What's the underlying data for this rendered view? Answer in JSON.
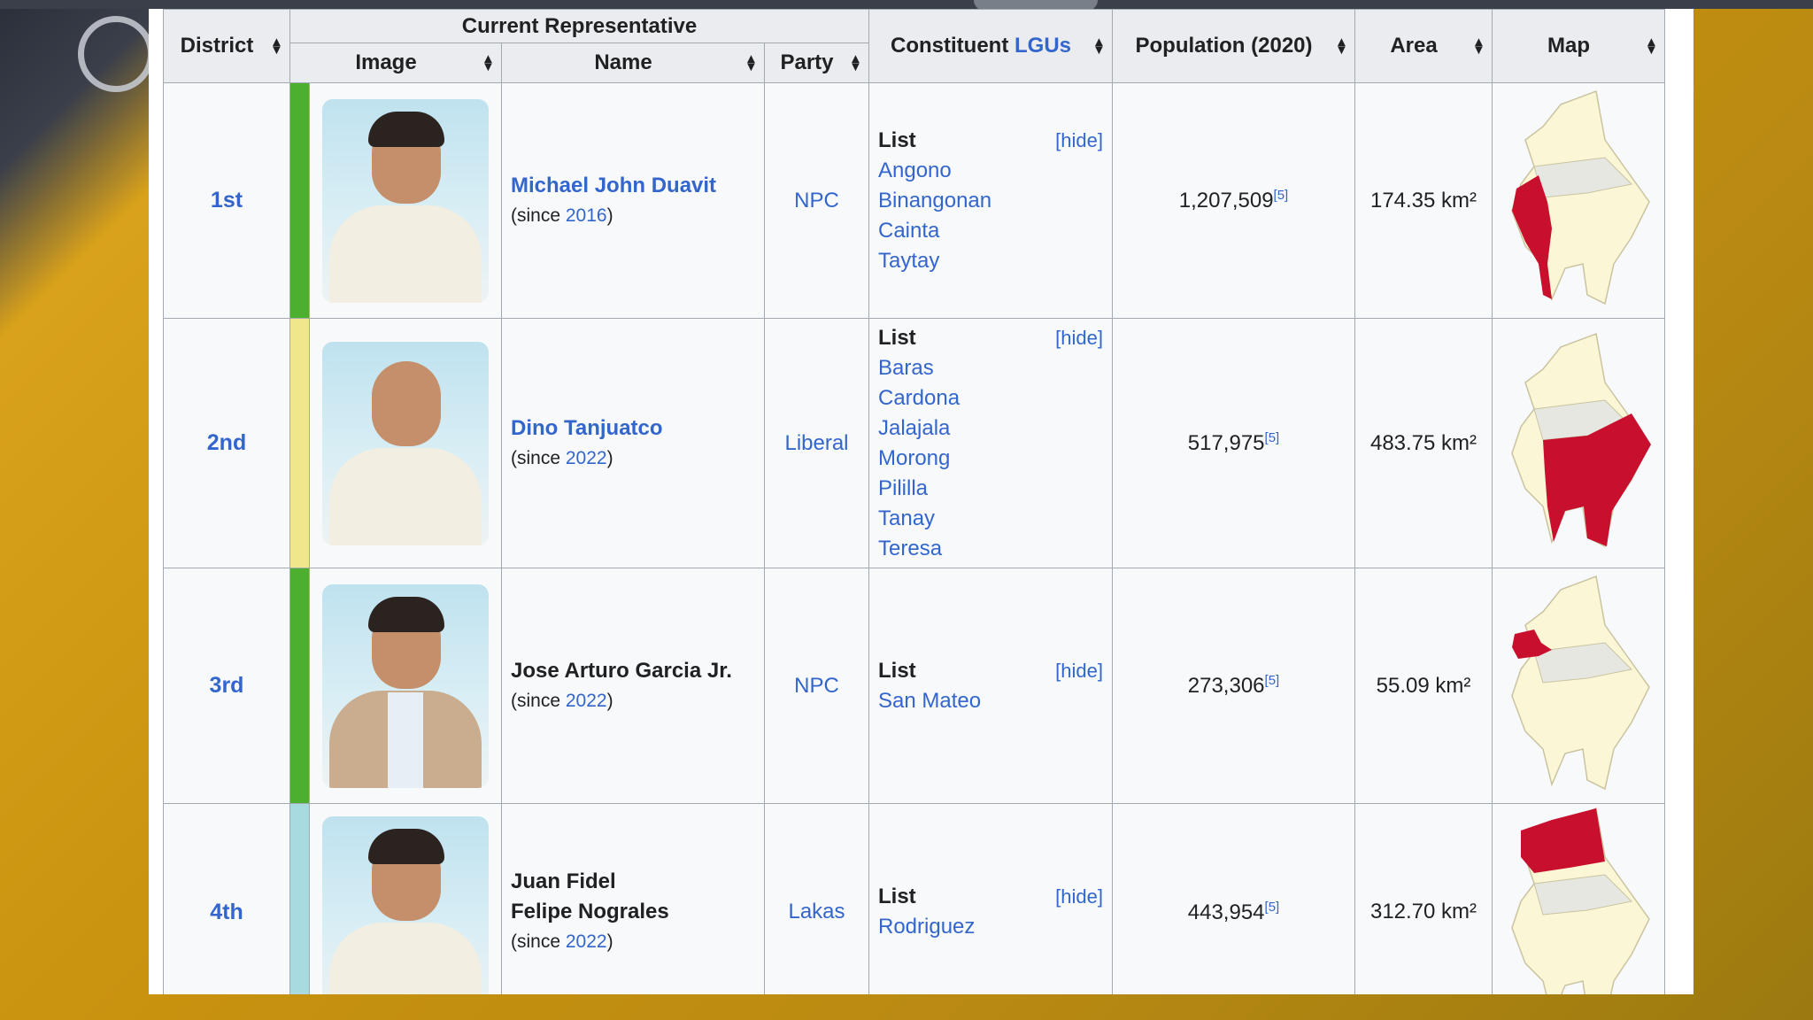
{
  "headers": {
    "district": "District",
    "current_rep": "Current Representative",
    "image": "Image",
    "name": "Name",
    "party": "Party",
    "lgus_prefix": "Constituent ",
    "lgus_link": "LGUs",
    "population": "Population (2020)",
    "area": "Area",
    "map": "Map"
  },
  "list_label": "List",
  "hide_label": "[hide]",
  "rows": [
    {
      "district": "1st",
      "bar_color": "#4caf2f",
      "name": "Michael John Duavit",
      "name_is_link": true,
      "since_prefix": "(since ",
      "since_year": "2016",
      "since_suffix": ")",
      "party": "NPC",
      "lgus": [
        "Angono",
        "Binangonan",
        "Cainta",
        "Taytay"
      ],
      "population": "1,207,509",
      "ref": "[5]",
      "area": "174.35 km²"
    },
    {
      "district": "2nd",
      "bar_color": "#f0e68c",
      "name": "Dino Tanjuatco",
      "name_is_link": true,
      "since_prefix": "(since ",
      "since_year": "2022",
      "since_suffix": ")",
      "party": "Liberal",
      "lgus": [
        "Baras",
        "Cardona",
        "Jalajala",
        "Morong",
        "Pililla",
        "Tanay",
        "Teresa"
      ],
      "population": "517,975",
      "ref": "[5]",
      "area": "483.75 km²"
    },
    {
      "district": "3rd",
      "bar_color": "#4caf2f",
      "name": "Jose Arturo Garcia Jr.",
      "name_is_link": false,
      "since_prefix": "(since ",
      "since_year": "2022",
      "since_suffix": ")",
      "party": "NPC",
      "lgus": [
        "San Mateo"
      ],
      "population": "273,306",
      "ref": "[5]",
      "area": "55.09 km²"
    },
    {
      "district": "4th",
      "bar_color": "#a8dbe0",
      "name": "Juan Fidel Felipe Nograles",
      "name_line1": "Juan Fidel",
      "name_line2": "Felipe Nograles",
      "name_is_link": false,
      "since_prefix": "(since ",
      "since_year": "2022",
      "since_suffix": ")",
      "party": "Lakas",
      "lgus": [
        "Rodriguez"
      ],
      "population": "443,954",
      "ref": "[5]",
      "area": "312.70 km²"
    }
  ],
  "colors": {
    "link": "#3366cc",
    "header_bg": "#eaecf0",
    "cell_bg": "#f8f9fa",
    "map_base": "#fbf6d6",
    "map_highlight": "#c8102e"
  }
}
